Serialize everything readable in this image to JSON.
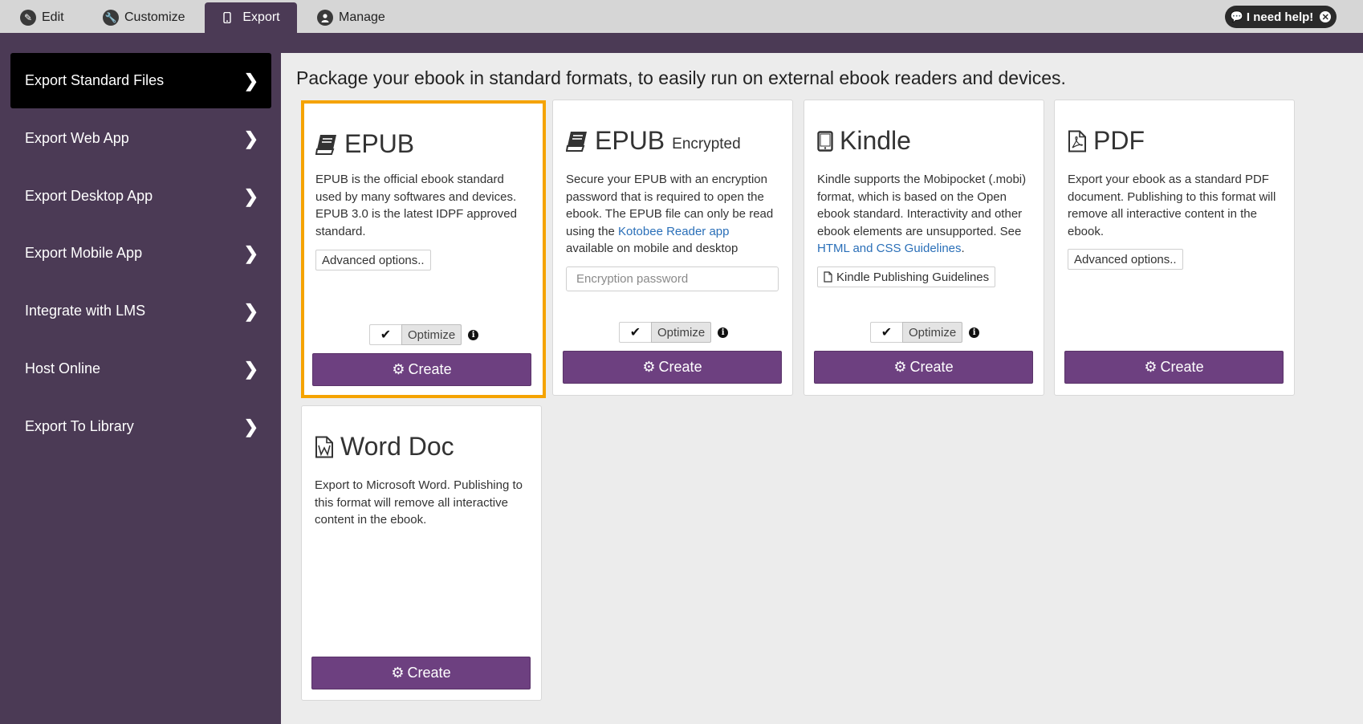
{
  "topbar": {
    "tabs": [
      {
        "label": "Edit",
        "icon": "pencil-icon"
      },
      {
        "label": "Customize",
        "icon": "wrench-icon"
      },
      {
        "label": "Export",
        "icon": "mobile-icon"
      },
      {
        "label": "Manage",
        "icon": "user-icon"
      }
    ],
    "help_label": "I need help!"
  },
  "sidebar": {
    "items": [
      {
        "label": "Export Standard Files"
      },
      {
        "label": "Export Web App"
      },
      {
        "label": "Export Desktop App"
      },
      {
        "label": "Export Mobile App"
      },
      {
        "label": "Integrate with LMS"
      },
      {
        "label": "Host Online"
      },
      {
        "label": "Export To Library"
      }
    ]
  },
  "main": {
    "headline": "Package your ebook in standard formats, to easily run on external ebook readers and devices.",
    "cards": {
      "epub": {
        "title": "EPUB",
        "desc": "EPUB is the official ebook standard used by many softwares and devices. EPUB 3.0 is the latest IDPF approved standard.",
        "options_label": "Advanced options..",
        "optimize_label": "Optimize",
        "create_label": "Create"
      },
      "epub_enc": {
        "title": "EPUB",
        "subtitle": "Encrypted",
        "desc_before": "Secure your EPUB with an encryption password that is required to open the ebook. The EPUB file can only be read using the ",
        "link": "Kotobee Reader app",
        "desc_after": " available on mobile and desktop",
        "password_placeholder": "Encryption password",
        "optimize_label": "Optimize",
        "create_label": "Create"
      },
      "kindle": {
        "title": "Kindle",
        "desc_before": "Kindle supports the Mobipocket (.mobi) format, which is based on the Open ebook standard. Interactivity and other ebook elements are unsupported. See ",
        "link": "HTML and CSS Guidelines",
        "desc_after": ".",
        "guide_label": "Kindle Publishing Guidelines",
        "optimize_label": "Optimize",
        "create_label": "Create"
      },
      "pdf": {
        "title": "PDF",
        "desc": "Export your ebook as a standard PDF document. Publishing to this format will remove all interactive content in the ebook.",
        "options_label": "Advanced options..",
        "create_label": "Create"
      },
      "word": {
        "title": "Word Doc",
        "desc": "Export to Microsoft Word. Publishing to this format will remove all interactive content in the ebook.",
        "create_label": "Create"
      }
    }
  },
  "colors": {
    "accent_purple": "#6d4080",
    "sidebar_bg": "#4b3a55",
    "selected_border": "#f5a300",
    "link": "#2a6fb8"
  }
}
